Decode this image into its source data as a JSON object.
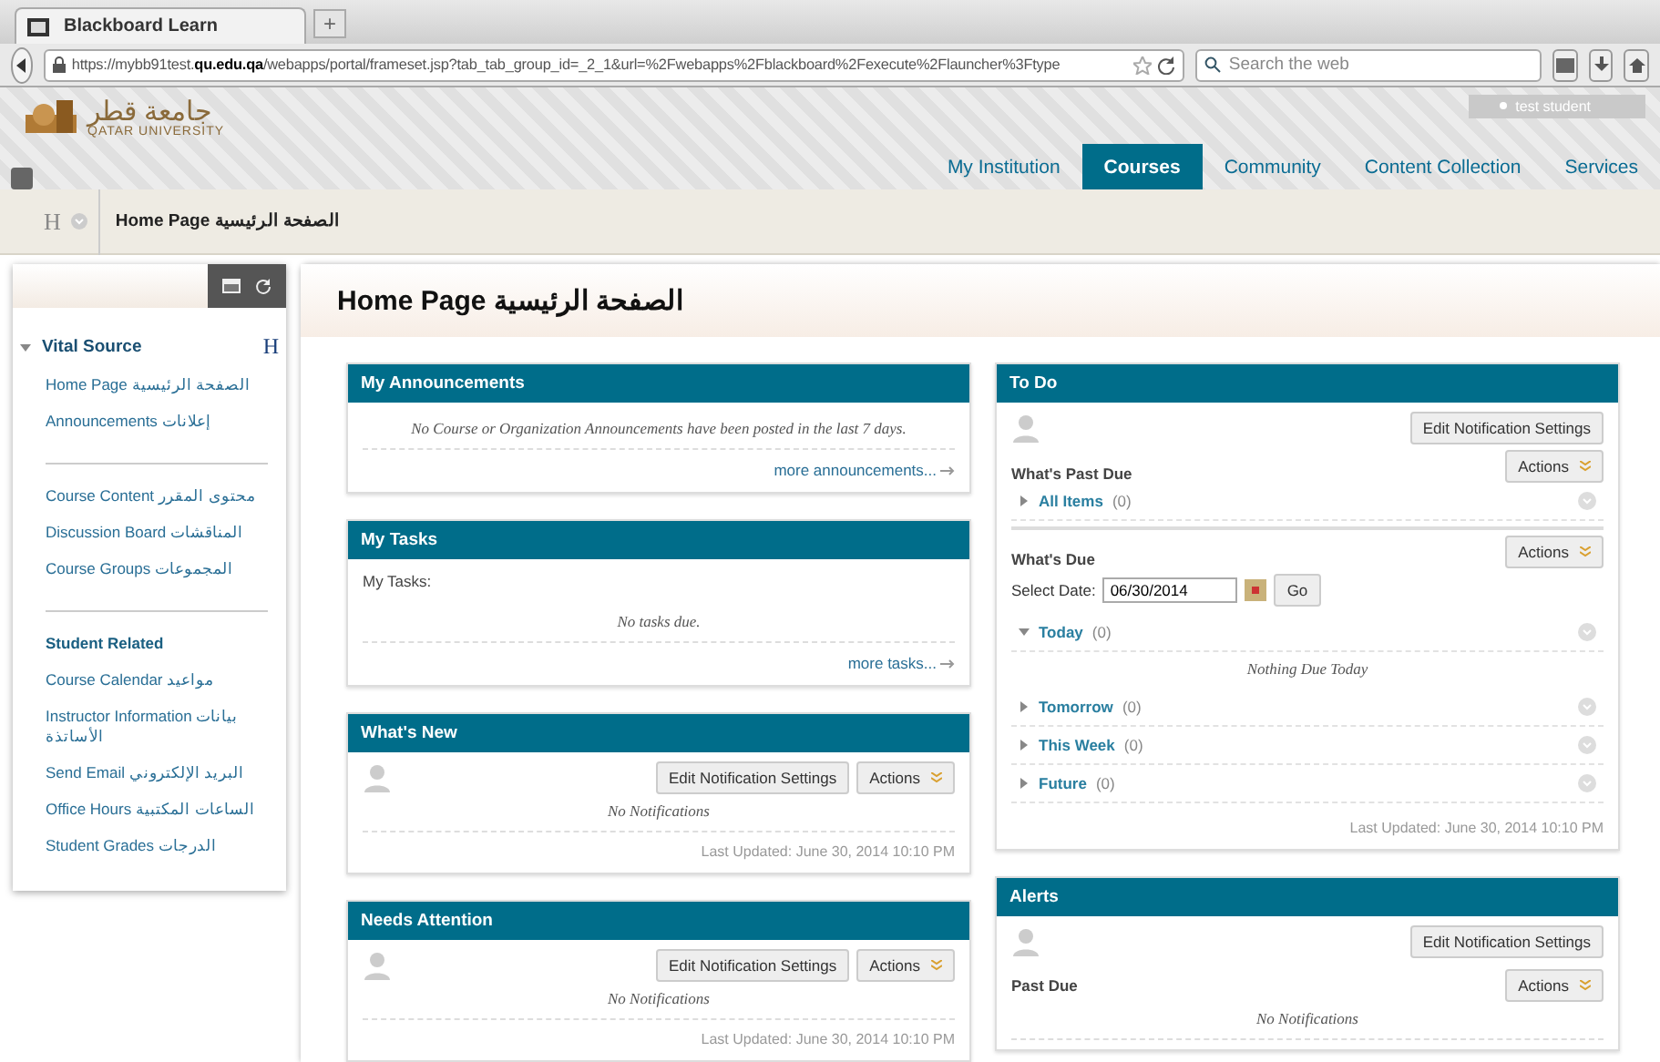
{
  "browser": {
    "tab_title": "Blackboard Learn",
    "new_tab": "+",
    "url": "https://mybb91test.**qu.edu.qa**/webapps/portal/frameset.jsp?tab_tab_group_id=_2_1&url=%2Fwebapps%2Fblackboard%2Fexecute%2Flauncher%3Ftype",
    "search_placeholder": "Search the web"
  },
  "header": {
    "logo_arabic": "جامعة قطر",
    "logo_english": "QATAR UNIVERSITY",
    "user": "test student",
    "tabs": [
      {
        "label": "My Institution",
        "selected": false
      },
      {
        "label": "Courses",
        "selected": true
      },
      {
        "label": "Community",
        "selected": false
      },
      {
        "label": "Content Collection",
        "selected": false
      },
      {
        "label": "Services",
        "selected": false
      }
    ]
  },
  "breadcrumb": {
    "mark": "H",
    "label": "Home Page الصفحة الرئيسية"
  },
  "sidebar": {
    "course": "Vital Source",
    "expanded": true,
    "mark": "H",
    "groups": [
      {
        "items": [
          {
            "kind": "link",
            "label": "Home Page الصفحة الرئيسية"
          },
          {
            "kind": "link",
            "label": "Announcements إعلانات"
          }
        ]
      },
      {
        "items": [
          {
            "kind": "link",
            "label": "Course Content محتوى المقرر"
          },
          {
            "kind": "link",
            "label": "Discussion Board المناقشات"
          },
          {
            "kind": "link",
            "label": "Course Groups المجموعات"
          }
        ]
      },
      {
        "items": [
          {
            "kind": "heading",
            "label": "Student Related"
          },
          {
            "kind": "link",
            "label": "Course Calendar مواعيد"
          },
          {
            "kind": "link",
            "label": "Instructor Information بيانات الأساتذة"
          },
          {
            "kind": "link",
            "label": "Send Email البريد الإلكتروني"
          },
          {
            "kind": "link",
            "label": "Office Hours الساعات المكتبية"
          },
          {
            "kind": "link",
            "label": "Student Grades الدرجات"
          }
        ]
      }
    ]
  },
  "page_title": "Home Page الصفحة الرئيسية",
  "columns": [
    [
      {
        "kind": "list",
        "title": "My Announcements",
        "message": "No Course or Organization Announcements have been posted in the last 7 days.",
        "link": "more announcements..."
      },
      {
        "kind": "list",
        "title": "My Tasks",
        "label": "My Tasks:",
        "message": "No tasks due.",
        "link": "more tasks..."
      },
      {
        "kind": "notify",
        "title": "What's New",
        "edit": "Edit Notification Settings",
        "actions": "Actions",
        "message": "No Notifications",
        "updated": "Last Updated: June 30, 2014 10:10 PM"
      },
      {
        "kind": "notify",
        "title": "Needs Attention",
        "edit": "Edit Notification Settings",
        "actions": "Actions",
        "message": "No Notifications",
        "updated": "Last Updated: June 30, 2014 10:10 PM"
      }
    ],
    [
      {
        "kind": "todo",
        "title": "To Do",
        "edit": "Edit Notification Settings",
        "sections": [
          {
            "title": "What's Past Due",
            "actions": "Actions",
            "groups": [
              {
                "label": "All Items",
                "count": "(0)",
                "expanded": false
              }
            ]
          },
          {
            "title": "What's Due",
            "actions": "Actions",
            "date_label": "Select Date:",
            "date": "06/30/2014",
            "go": "Go",
            "groups": [
              {
                "label": "Today",
                "count": "(0)",
                "expanded": true,
                "message": "Nothing Due Today"
              },
              {
                "label": "Tomorrow",
                "count": "(0)",
                "expanded": false
              },
              {
                "label": "This Week",
                "count": "(0)",
                "expanded": false
              },
              {
                "label": "Future",
                "count": "(0)",
                "expanded": false
              }
            ]
          }
        ],
        "updated": "Last Updated: June 30, 2014 10:10 PM"
      },
      {
        "kind": "alerts",
        "title": "Alerts",
        "edit": "Edit Notification Settings",
        "section": "Past Due",
        "actions": "Actions",
        "message": "No Notifications"
      }
    ]
  ]
}
